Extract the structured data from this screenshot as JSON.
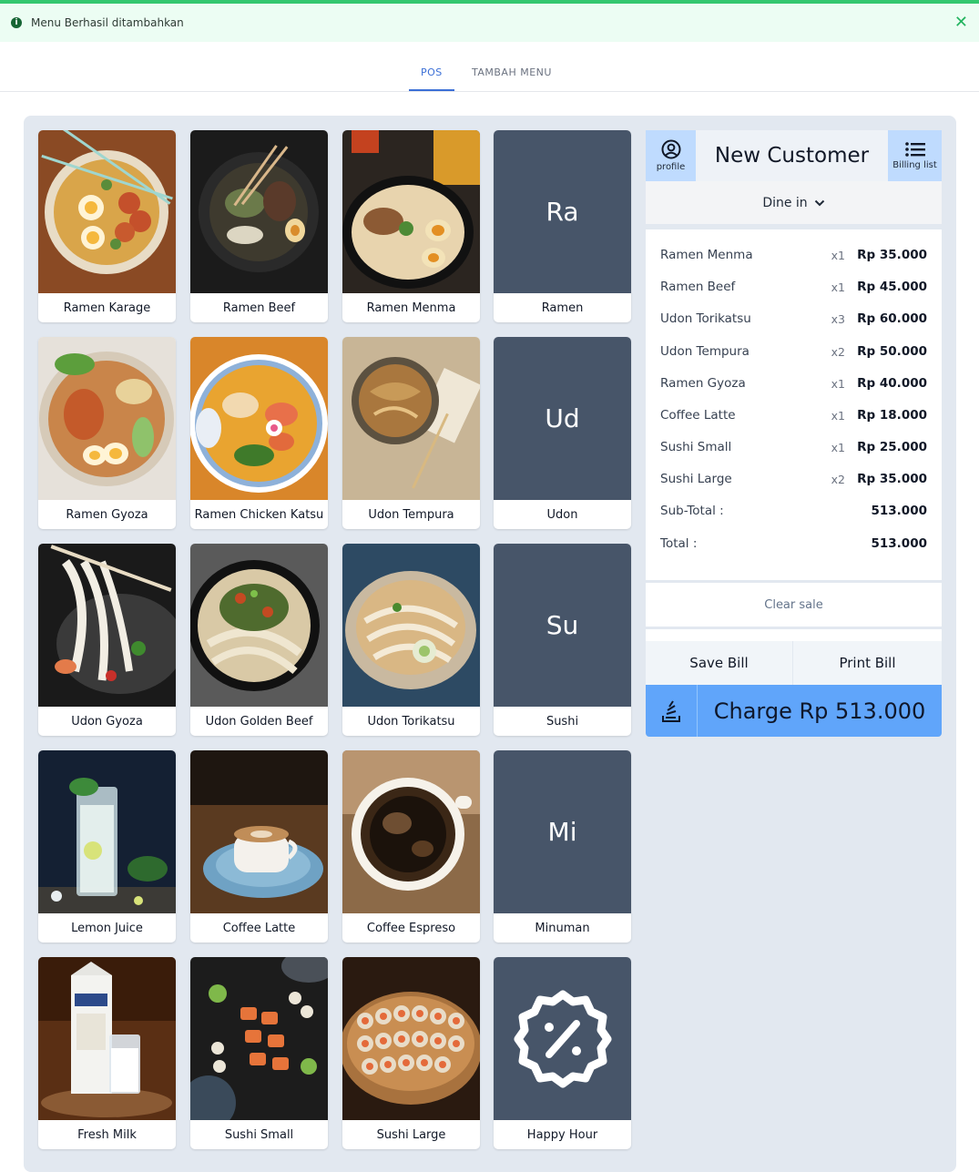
{
  "toast": {
    "message": "Menu Berhasil ditambahkan"
  },
  "tabs": [
    {
      "label": "POS"
    },
    {
      "label": "TAMBAH MENU"
    }
  ],
  "menu": [
    {
      "label": "Ramen Karage"
    },
    {
      "label": "Ramen Beef"
    },
    {
      "label": "Ramen Menma"
    },
    {
      "label": "Ramen",
      "initials": "Ra"
    },
    {
      "label": "Ramen Gyoza"
    },
    {
      "label": "Ramen Chicken Katsu"
    },
    {
      "label": "Udon Tempura"
    },
    {
      "label": "Udon",
      "initials": "Ud"
    },
    {
      "label": "Udon Gyoza"
    },
    {
      "label": "Udon Golden Beef"
    },
    {
      "label": "Udon Torikatsu"
    },
    {
      "label": "Sushi",
      "initials": "Su"
    },
    {
      "label": "Lemon Juice"
    },
    {
      "label": "Coffee Latte"
    },
    {
      "label": "Coffee Espreso"
    },
    {
      "label": "Minuman",
      "initials": "Mi"
    },
    {
      "label": "Fresh Milk"
    },
    {
      "label": "Sushi Small"
    },
    {
      "label": "Sushi Large"
    },
    {
      "label": "Happy Hour",
      "icon": "discount-badge-icon"
    }
  ],
  "cart": {
    "profile_label": "profile",
    "customer": "New Customer",
    "billing_label": "Billing list",
    "order_type": "Dine in",
    "items": [
      {
        "name": "Ramen Menma",
        "qty": "x1",
        "price": "Rp 35.000"
      },
      {
        "name": "Ramen Beef",
        "qty": "x1",
        "price": "Rp 45.000"
      },
      {
        "name": "Udon Torikatsu",
        "qty": "x3",
        "price": "Rp 60.000"
      },
      {
        "name": "Udon Tempura",
        "qty": "x2",
        "price": "Rp 50.000"
      },
      {
        "name": "Ramen Gyoza",
        "qty": "x1",
        "price": "Rp 40.000"
      },
      {
        "name": "Coffee Latte",
        "qty": "x1",
        "price": "Rp 18.000"
      },
      {
        "name": "Sushi Small",
        "qty": "x1",
        "price": "Rp 25.000"
      },
      {
        "name": "Sushi Large",
        "qty": "x2",
        "price": "Rp 35.000"
      }
    ],
    "subtotal_label": "Sub-Total :",
    "subtotal": "513.000",
    "total_label": "Total :",
    "total": "513.000",
    "clear_label": "Clear sale",
    "save_label": "Save Bill",
    "print_label": "Print Bill",
    "charge_label": "Charge Rp 513.000"
  },
  "colors": {
    "accent": "#3b6fd6",
    "charge": "#60a5fa",
    "category": "#475569",
    "toast": "#ecfdf3"
  }
}
